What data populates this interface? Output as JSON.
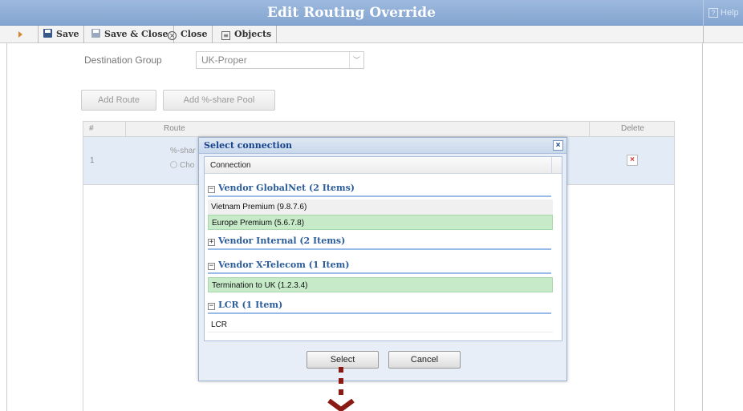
{
  "window": {
    "title": "Edit Routing Override",
    "help": "Help"
  },
  "toolbar": {
    "save": "Save",
    "save_close": "Save & Close",
    "close": "Close",
    "objects": "Objects"
  },
  "form": {
    "destination_group_label": "Destination Group",
    "destination_group_value": "UK-Proper",
    "add_route": "Add Route",
    "add_share_pool": "Add %-share Pool"
  },
  "grid": {
    "columns": [
      "#",
      "Route",
      "Delete"
    ],
    "row_number": "1",
    "row_route_partial": "%-shar",
    "row_radio_partial": "Cho"
  },
  "modal": {
    "title": "Select connection",
    "column_header": "Connection",
    "groups": [
      {
        "label": "Vendor GlobalNet (2 Items)",
        "expanded": true,
        "items": [
          "Vietnam Premium (9.8.7.6)",
          "Europe Premium (5.6.7.8)"
        ]
      },
      {
        "label": "Vendor Internal (2 Items)",
        "expanded": false,
        "items": []
      },
      {
        "label": "Vendor X-Telecom (1 Item)",
        "expanded": true,
        "items": [
          "Termination to UK (1.2.3.4)"
        ]
      },
      {
        "label": "LCR (1 Item)",
        "expanded": true,
        "items": [
          "LCR"
        ]
      }
    ],
    "select_button": "Select",
    "cancel_button": "Cancel"
  },
  "colors": {
    "title_bar": "#8fadd6",
    "group_text": "#2b5c9a",
    "selected_row": "#c7eac9",
    "annotation_arrow": "#8a1a14"
  }
}
